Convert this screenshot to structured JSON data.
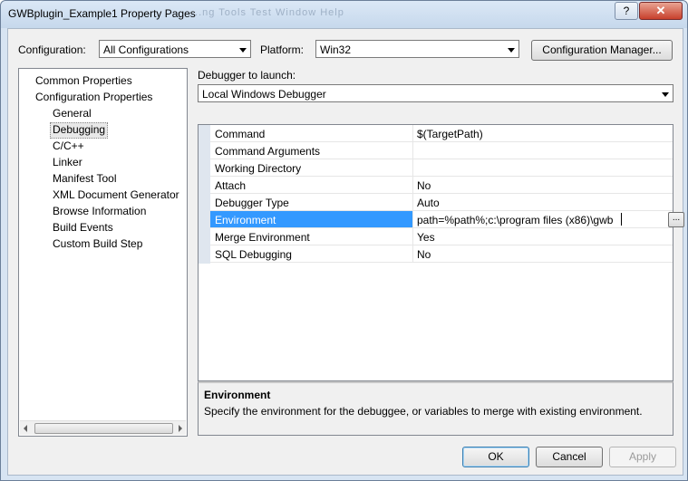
{
  "window": {
    "title": "GWBplugin_Example1 Property Pages",
    "title_ghost": "...ng  Tools  Test  Window  Help",
    "help_glyph": "?",
    "close_glyph": "✕"
  },
  "config": {
    "configuration_label": "Configuration:",
    "configuration_value": "All Configurations",
    "platform_label": "Platform:",
    "platform_value": "Win32",
    "manager_button": "Configuration Manager..."
  },
  "tree": {
    "items": [
      {
        "label": "Common Properties"
      },
      {
        "label": "Configuration Properties"
      },
      {
        "label": "General"
      },
      {
        "label": "Debugging"
      },
      {
        "label": "C/C++"
      },
      {
        "label": "Linker"
      },
      {
        "label": "Manifest Tool"
      },
      {
        "label": "XML Document Generator"
      },
      {
        "label": "Browse Information"
      },
      {
        "label": "Build Events"
      },
      {
        "label": "Custom Build Step"
      }
    ],
    "selected": "Debugging"
  },
  "debugger": {
    "launch_label": "Debugger to launch:",
    "launch_value": "Local Windows Debugger"
  },
  "properties": [
    {
      "name": "Command",
      "value": "$(TargetPath)"
    },
    {
      "name": "Command Arguments",
      "value": ""
    },
    {
      "name": "Working Directory",
      "value": ""
    },
    {
      "name": "Attach",
      "value": "No"
    },
    {
      "name": "Debugger Type",
      "value": "Auto"
    },
    {
      "name": "Environment",
      "value": "path=%path%;c:\\program files (x86)\\gwb"
    },
    {
      "name": "Merge Environment",
      "value": "Yes"
    },
    {
      "name": "SQL Debugging",
      "value": "No"
    }
  ],
  "ellipsis_label": "...",
  "description": {
    "title": "Environment",
    "text": "Specify the environment for the debuggee, or variables to merge with existing environment."
  },
  "buttons": {
    "ok": "OK",
    "cancel": "Cancel",
    "apply": "Apply"
  }
}
